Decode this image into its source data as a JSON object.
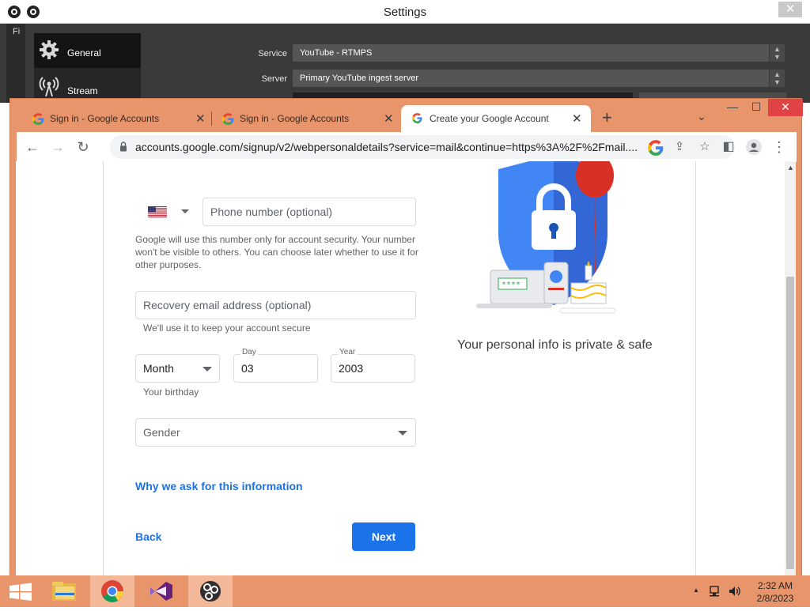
{
  "obs": {
    "title": "Settings",
    "close_label": "✕",
    "left_strip_text": "Fi",
    "sidebar": [
      {
        "label": "General"
      },
      {
        "label": "Stream"
      }
    ],
    "service_label": "Service",
    "service_value": "YouTube - RTMPS",
    "server_label": "Server",
    "server_value": "Primary YouTube ingest server"
  },
  "chrome": {
    "tabs": [
      {
        "title": "Sign in - Google Accounts",
        "active": false
      },
      {
        "title": "Sign in - Google Accounts",
        "active": false
      },
      {
        "title": "Create your Google Account",
        "active": true
      }
    ],
    "new_tab_label": "+",
    "url": "accounts.google.com/signup/v2/webpersonaldetails?service=mail&continue=https%3A%2F%2Fmail....",
    "window_buttons": {
      "minimize": "—",
      "maximize": "☐",
      "close": "✕"
    }
  },
  "form": {
    "phone_placeholder": "Phone number (optional)",
    "phone_help": "Google will use this number only for account security. Your number won't be visible to others. You can choose later whether to use it for other purposes.",
    "recovery_placeholder": "Recovery email address (optional)",
    "recovery_help": "We'll use it to keep your account secure",
    "month_value": "Month",
    "day_label": "Day",
    "day_value": "03",
    "year_label": "Year",
    "year_value": "2003",
    "birthday_help": "Your birthday",
    "gender_value": "Gender",
    "why_link": "Why we ask for this information",
    "back_label": "Back",
    "next_label": "Next"
  },
  "side": {
    "privacy_text": "Your personal info is private & safe",
    "password_stars": "****"
  },
  "taskbar": {
    "time": "2:32 AM",
    "date": "2/8/2023"
  },
  "colors": {
    "accent_blue": "#1a73e8",
    "chrome_frame": "#e9956b",
    "obs_dark": "#3a3a3a"
  }
}
